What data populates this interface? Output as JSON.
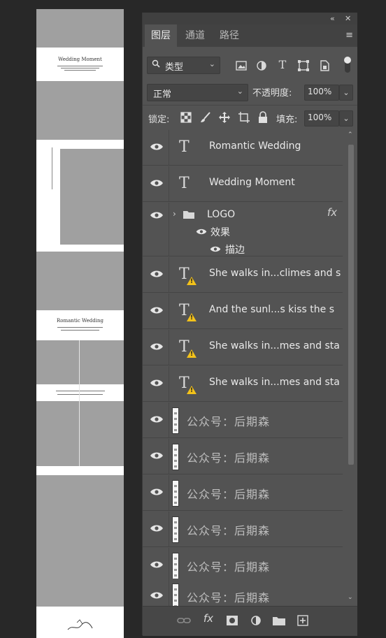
{
  "document": {
    "card1_title": "Wedding Moment",
    "card2_title": "Romantic Wedding"
  },
  "panel": {
    "collapse_icon": "«",
    "close_icon": "✕",
    "tabs": [
      {
        "label": "图层",
        "active": true
      },
      {
        "label": "通道",
        "active": false
      },
      {
        "label": "路径",
        "active": false
      }
    ],
    "menu_icon": "≡",
    "filter": {
      "label": "类型",
      "icons": [
        "image-filter-icon",
        "adjustment-filter-icon",
        "type-filter-icon",
        "shape-filter-icon",
        "smartobject-filter-icon"
      ]
    },
    "blend_mode": "正常",
    "opacity_label": "不透明度:",
    "opacity_value": "100%",
    "lock_label": "锁定:",
    "fill_label": "填充:",
    "fill_value": "100%",
    "layers": [
      {
        "type": "text",
        "name": "Romantic Wedding"
      },
      {
        "type": "text",
        "name": "Wedding Moment"
      },
      {
        "type": "group",
        "name": "LOGO",
        "fx": "fx",
        "effects_label": "效果",
        "effect": "描边"
      },
      {
        "type": "text-warn",
        "name": "She walks in...climes and s"
      },
      {
        "type": "text-warn",
        "name": "And the sunl...s kiss the s"
      },
      {
        "type": "text-warn",
        "name": "She walks in...mes and sta"
      },
      {
        "type": "text-warn",
        "name": "She walks in...mes and sta"
      },
      {
        "type": "watermark",
        "name": "公众号：后期森"
      },
      {
        "type": "watermark",
        "name": "公众号：后期森"
      },
      {
        "type": "watermark",
        "name": "公众号：后期森"
      },
      {
        "type": "watermark",
        "name": "公众号：后期森"
      },
      {
        "type": "watermark",
        "name": "公众号：后期森"
      },
      {
        "type": "watermark",
        "name": "公众号：后期森"
      }
    ],
    "colors": {
      "panel": "#535353",
      "warning": "#f3c21a",
      "background": "#282828"
    }
  }
}
